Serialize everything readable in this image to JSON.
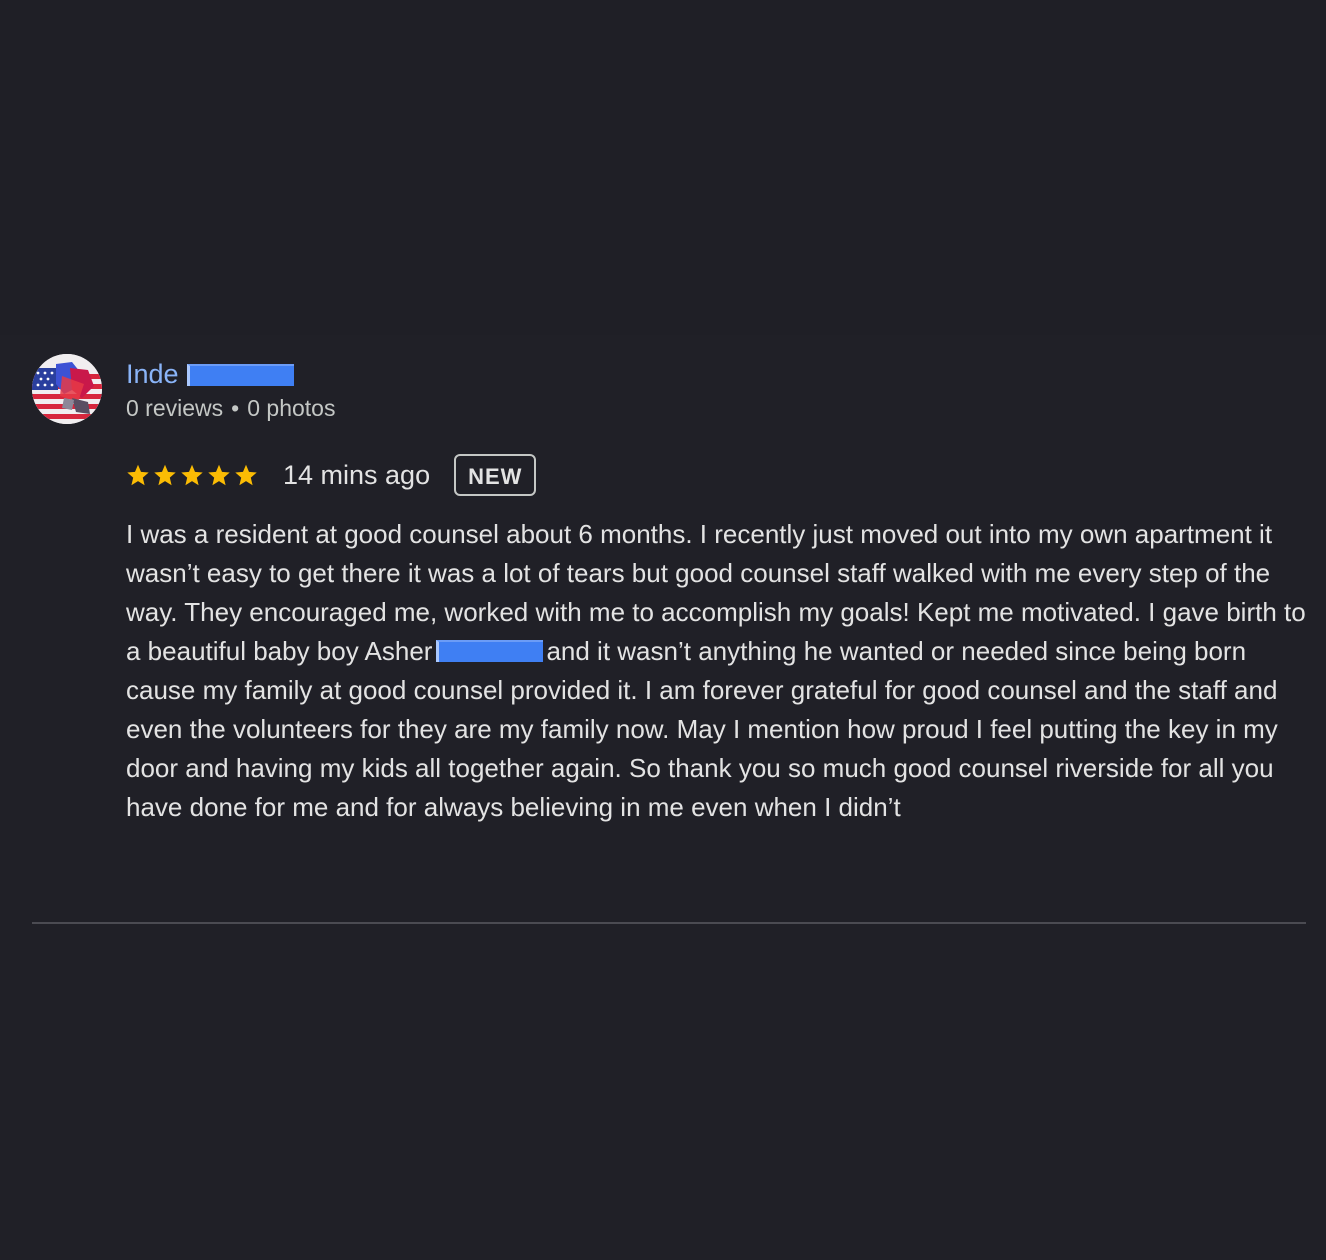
{
  "reviewer": {
    "name": "Inde",
    "stats": {
      "reviews": "0 reviews",
      "separator": "•",
      "photos": "0 photos"
    }
  },
  "review": {
    "rating": 5,
    "rating_max": 5,
    "time": "14 mins ago",
    "badge": "NEW",
    "text_part1": "I was a resident at good counsel about 6 months. I recently just moved out into my own apartment it wasn’t easy to get there it was a lot of tears but good counsel staff walked with me every step of the way. They encouraged me, worked with me to accomplish my goals! Kept me motivated. I gave birth to a beautiful baby boy Asher",
    "text_part2": "and it wasn’t anything he wanted or needed since being born cause my family at good counsel provided it. I am forever grateful for good counsel and the staff and even the volunteers for they are my family now. May I mention how proud I feel putting the key in my door and having my kids all together again. So thank you so much good counsel riverside for all you have done for me and for always believing in me even when I didn’t"
  },
  "colors": {
    "background": "#202027",
    "name_link": "#8ab4f8",
    "star": "#fbbc04",
    "redaction": "#3f7ff3"
  },
  "icons": {
    "avatar": "avatar-flag-image",
    "star": "star-icon"
  }
}
